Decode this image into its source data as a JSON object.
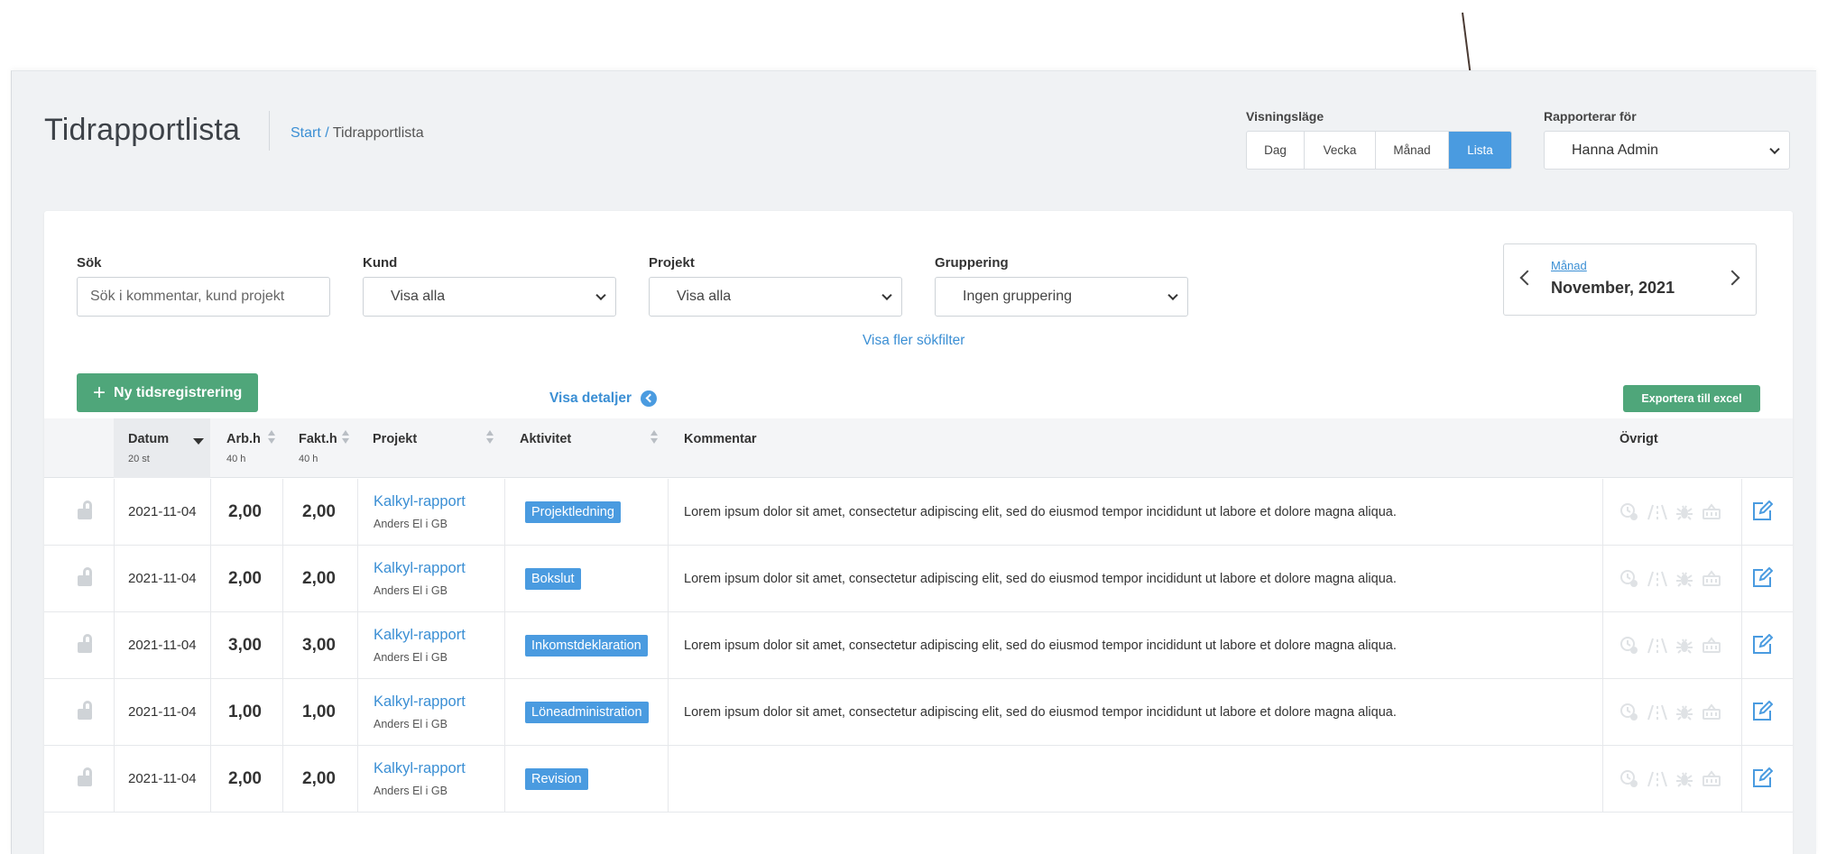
{
  "page": {
    "title": "Tidrapportlista",
    "breadcrumb": {
      "home": "Start /",
      "current": "Tidrapportlista"
    }
  },
  "view_mode": {
    "label": "Visningsläge",
    "options": [
      "Dag",
      "Vecka",
      "Månad",
      "Lista"
    ],
    "selected": "Lista"
  },
  "reporting_for": {
    "label": "Rapporterar för",
    "value": "Hanna Admin"
  },
  "filters": {
    "search": {
      "label": "Sök",
      "placeholder": "Sök i kommentar, kund projekt"
    },
    "customer": {
      "label": "Kund",
      "value": "Visa alla"
    },
    "project": {
      "label": "Projekt",
      "value": "Visa alla"
    },
    "grouping": {
      "label": "Gruppering",
      "value": "Ingen gruppering"
    },
    "more_filters": "Visa fler sökfilter"
  },
  "period": {
    "type_link": "Månad",
    "value": "November, 2021"
  },
  "actions": {
    "new_entry": "Ny tidsregistrering",
    "new_entry_icon": "+",
    "show_details": "Visa detaljer",
    "export": "Exportera till excel"
  },
  "table": {
    "columns": {
      "date": {
        "label": "Datum",
        "sub": "20 st"
      },
      "work_hours": {
        "label": "Arb.h",
        "sub": "40 h"
      },
      "billed_hours": {
        "label": "Fakt.h",
        "sub": "40 h"
      },
      "project": {
        "label": "Projekt"
      },
      "activity": {
        "label": "Aktivitet"
      },
      "comment": {
        "label": "Kommentar"
      },
      "other": {
        "label": "Övrigt"
      }
    },
    "rows": [
      {
        "date": "2021-11-04",
        "work": "2,00",
        "billed": "2,00",
        "project": "Kalkyl-rapport",
        "customer": "Anders El i GB",
        "activity": "Projektledning",
        "comment": "Lorem ipsum dolor sit amet, consectetur adipiscing elit, sed do eiusmod tempor incididunt ut labore et dolore magna aliqua."
      },
      {
        "date": "2021-11-04",
        "work": "2,00",
        "billed": "2,00",
        "project": "Kalkyl-rapport",
        "customer": "Anders El i GB",
        "activity": "Bokslut",
        "comment": "Lorem ipsum dolor sit amet, consectetur adipiscing elit, sed do eiusmod tempor incididunt ut labore et dolore magna aliqua."
      },
      {
        "date": "2021-11-04",
        "work": "3,00",
        "billed": "3,00",
        "project": "Kalkyl-rapport",
        "customer": "Anders El i GB",
        "activity": "Inkomstdeklaration",
        "comment": "Lorem ipsum dolor sit amet, consectetur adipiscing elit, sed do eiusmod tempor incididunt ut labore et dolore magna aliqua."
      },
      {
        "date": "2021-11-04",
        "work": "1,00",
        "billed": "1,00",
        "project": "Kalkyl-rapport",
        "customer": "Anders El i GB",
        "activity": "Löneadministration",
        "comment": "Lorem ipsum dolor sit amet, consectetur adipiscing elit, sed do eiusmod tempor incididunt ut labore et dolore magna aliqua."
      },
      {
        "date": "2021-11-04",
        "work": "2,00",
        "billed": "2,00",
        "project": "Kalkyl-rapport",
        "customer": "Anders El i GB",
        "activity": "Revision",
        "comment": ""
      }
    ]
  },
  "colors": {
    "accent_blue": "#4a9be0",
    "link_blue": "#3b8fd4",
    "action_green": "#4fa67a",
    "background": "#f0f2f4",
    "annotation_arrow": "#4a3a33"
  },
  "icons": {
    "row_lock": "unlocked-padlock-icon",
    "row_other": [
      "clock-add-icon",
      "road-icon",
      "bug-icon",
      "basket-icon"
    ],
    "row_edit": "edit-icon",
    "annotation": "annotation-arrow-icon"
  }
}
